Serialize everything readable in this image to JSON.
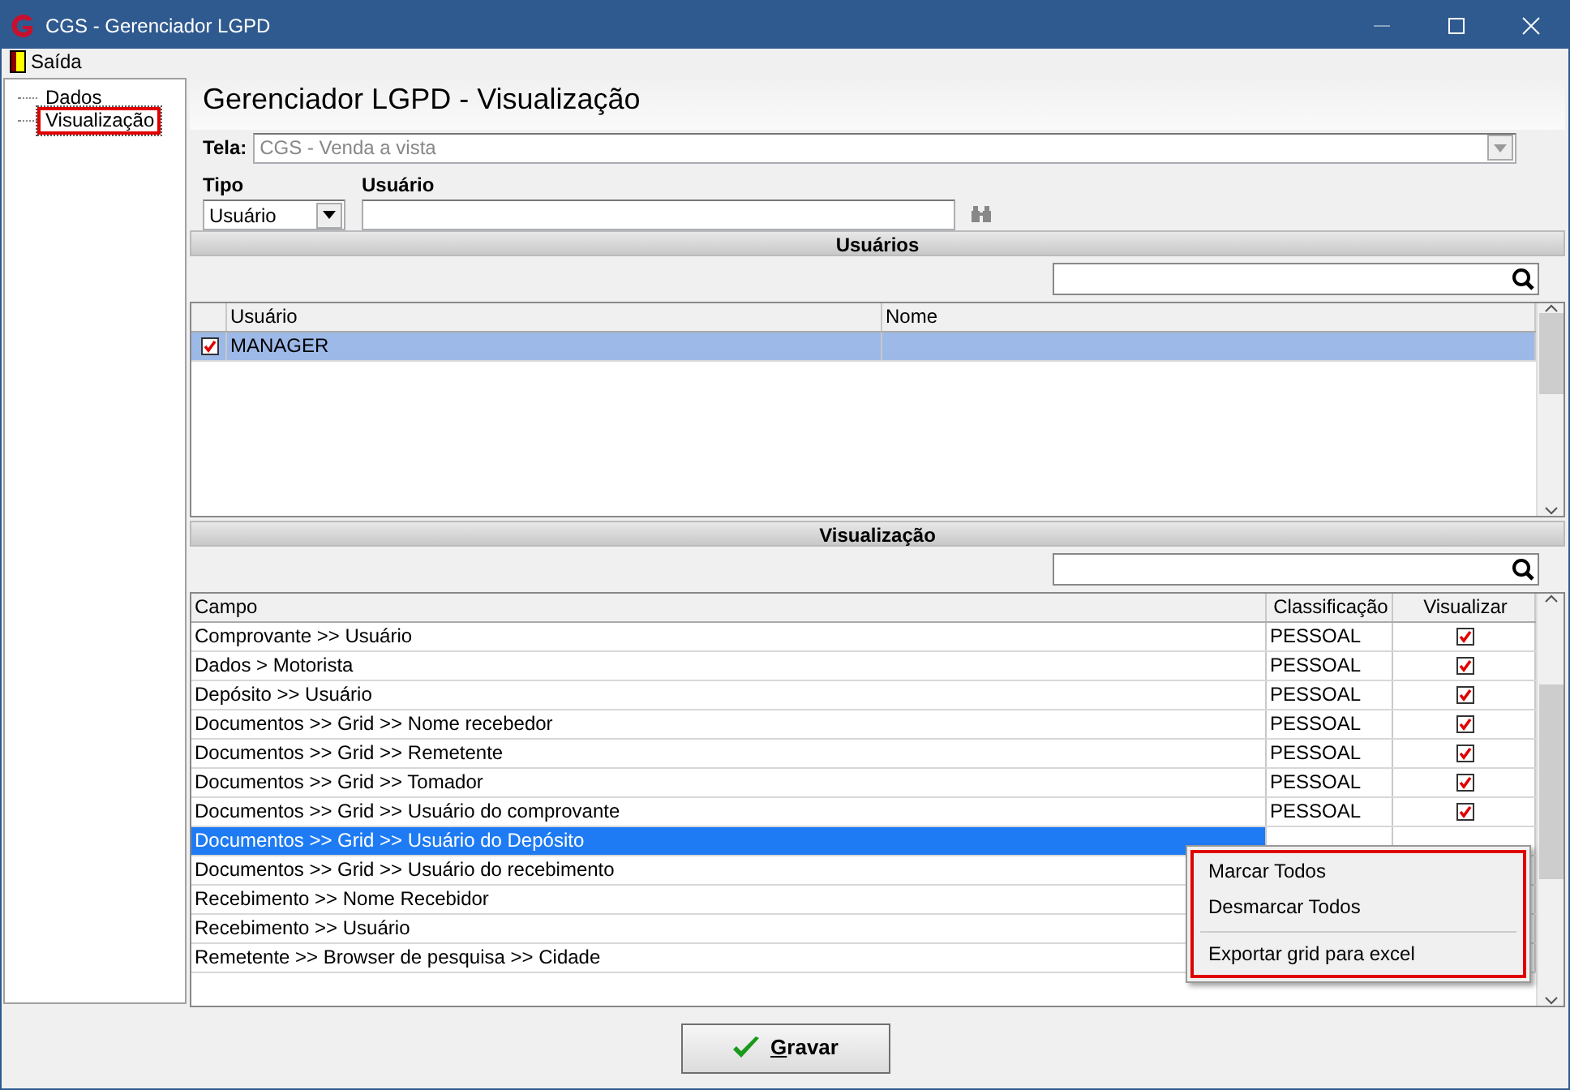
{
  "window": {
    "title": "CGS - Gerenciador LGPD"
  },
  "menu": [
    {
      "label": "Saída"
    }
  ],
  "tree": [
    {
      "label": "Dados",
      "selected": false,
      "annotated": false
    },
    {
      "label": "Visualização",
      "selected": true,
      "annotated": true
    }
  ],
  "heading": "Gerenciador LGPD - Visualização",
  "tela": {
    "label": "Tela:",
    "value": "CGS - Venda a vista",
    "disabled": true
  },
  "tipo": {
    "label": "Tipo",
    "value": "Usuário"
  },
  "usuario": {
    "label": "Usuário"
  },
  "users_panel": {
    "title": "Usuários",
    "columns": [
      "Usuário",
      "Nome"
    ],
    "rows": [
      {
        "usuario": "MANAGER",
        "nome": "",
        "checked": true,
        "selected": true
      }
    ]
  },
  "view_panel": {
    "title": "Visualização",
    "columns": [
      "Campo",
      "Classificação",
      "Visualizar"
    ],
    "rows": [
      {
        "campo": "Comprovante >> Usuário",
        "classificacao": "PESSOAL",
        "checked": true,
        "selected": false
      },
      {
        "campo": "Dados > Motorista",
        "classificacao": "PESSOAL",
        "checked": true,
        "selected": false
      },
      {
        "campo": "Depósito >> Usuário",
        "classificacao": "PESSOAL",
        "checked": true,
        "selected": false
      },
      {
        "campo": "Documentos >> Grid >> Nome recebedor",
        "classificacao": "PESSOAL",
        "checked": true,
        "selected": false
      },
      {
        "campo": "Documentos >> Grid >> Remetente",
        "classificacao": "PESSOAL",
        "checked": true,
        "selected": false
      },
      {
        "campo": "Documentos >> Grid >> Tomador",
        "classificacao": "PESSOAL",
        "checked": true,
        "selected": false
      },
      {
        "campo": "Documentos >> Grid >> Usuário do comprovante",
        "classificacao": "PESSOAL",
        "checked": true,
        "selected": false
      },
      {
        "campo": "Documentos >> Grid >> Usuário do Depósito",
        "selected": true
      },
      {
        "campo": "Documentos >> Grid >> Usuário do recebimento",
        "selected": false
      },
      {
        "campo": "Recebimento >> Nome Recebidor",
        "selected": false
      },
      {
        "campo": "Recebimento >> Usuário",
        "selected": false
      },
      {
        "campo": "Remetente >> Browser de pesquisa >> Cidade",
        "selected": false
      }
    ]
  },
  "context_menu": {
    "annotated": true,
    "items": [
      {
        "label": "Marcar Todos",
        "kind": "item"
      },
      {
        "label": "Desmarcar Todos",
        "kind": "item"
      },
      {
        "kind": "separator"
      },
      {
        "label": "Exportar grid para excel",
        "kind": "item"
      }
    ]
  },
  "save_button": {
    "label": "Gravar"
  }
}
